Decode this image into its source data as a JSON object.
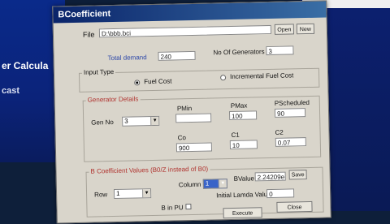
{
  "background": {
    "left_text_1": "er Calcula",
    "left_text_2": "cast"
  },
  "window": {
    "title": "BCoefficient"
  },
  "file": {
    "label": "File",
    "value": "D:\\bbb.bci",
    "open_label": "Open",
    "new_label": "New"
  },
  "totals": {
    "demand_label": "Total demand",
    "demand_value": "240",
    "generators_label": "No Of Generators",
    "generators_value": "3"
  },
  "input_type": {
    "label": "Input Type",
    "fuel_cost": "Fuel Cost",
    "incremental": "Incremental Fuel Cost",
    "selected": "fuel_cost"
  },
  "generator": {
    "title": "Generator Details",
    "gen_no_label": "Gen No",
    "gen_no_value": "3",
    "pmin_label": "PMin",
    "pmin_value": "",
    "pmax_label": "PMax",
    "pmax_value": "100",
    "psched_label": "PScheduled",
    "psched_value": "90",
    "c0_label": "Co",
    "c0_value": "900",
    "c1_label": "C1",
    "c1_value": "10",
    "c2_label": "C2",
    "c2_value": "0.07"
  },
  "bcoeff": {
    "title": "B Coefficient Values (B0/Z instead of B0)",
    "row_label": "Row",
    "row_value": "1",
    "column_label": "Column",
    "column_value": "1",
    "bvalue_label": "BValue",
    "bvalue_value": "2.24209e-",
    "save_label": "Save",
    "binpu_label": "B in PU",
    "lambda_label": "Initial Lamda Value",
    "lambda_value": "0"
  },
  "actions": {
    "execute_label": "Execute",
    "close_label": "Close"
  }
}
